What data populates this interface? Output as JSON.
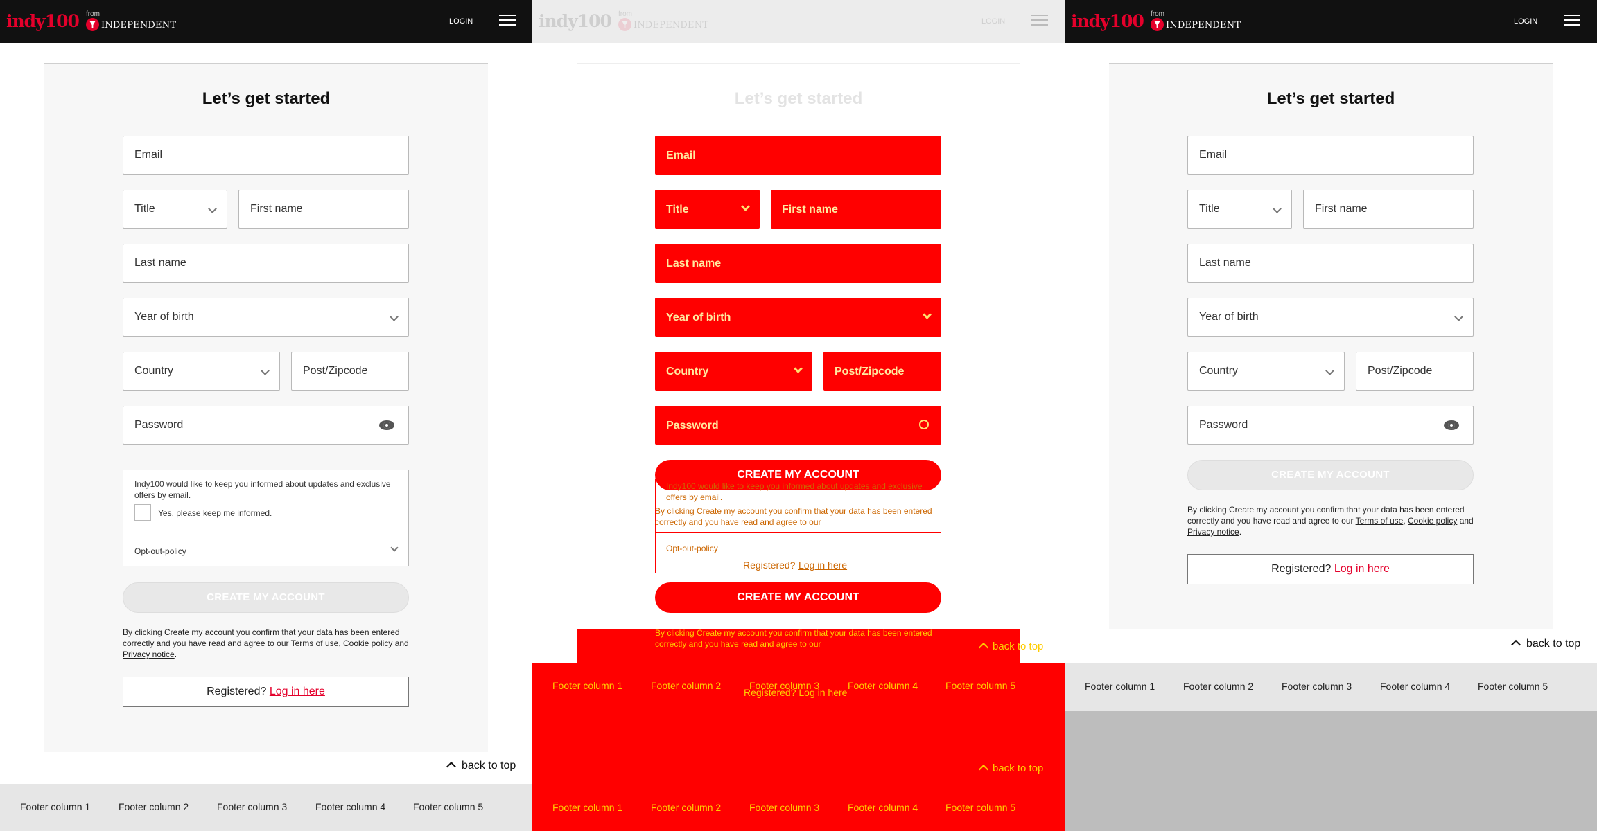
{
  "header": {
    "logo": "indy100",
    "from": "from",
    "publisher": "INDEPENDENT",
    "login": "LOGIN"
  },
  "form": {
    "title": "Let’s get started",
    "email": "Email",
    "title_select": "Title",
    "first_name": "First name",
    "last_name": "Last name",
    "year_of_birth": "Year of birth",
    "country": "Country",
    "postcode": "Post/Zipcode",
    "password": "Password",
    "consent_text": "Indy100 would like to keep you informed about updates and exclusive offers by email.",
    "consent_checkbox": "Yes, please keep me informed.",
    "opt_out": "Opt-out-policy",
    "cta": "CREATE MY ACCOUNT",
    "legal_prefix": "By clicking Create my account you confirm that your data has been entered correctly and you have read and agree to our",
    "terms": "Terms of use",
    "cookie": "Cookie policy",
    "and": "and",
    "privacy": "Privacy notice",
    "registered": "Registered?",
    "login_here": "Log in here"
  },
  "back_to_top": "back to top",
  "footer": {
    "columns": [
      "Footer column 1",
      "Footer column 2",
      "Footer column 3",
      "Footer column 4",
      "Footer column 5"
    ]
  },
  "colors": {
    "brand_red": "#e4002b",
    "header_bg": "#111111",
    "highlight_red": "#ff0000",
    "highlight_text": "#ffcc00"
  }
}
